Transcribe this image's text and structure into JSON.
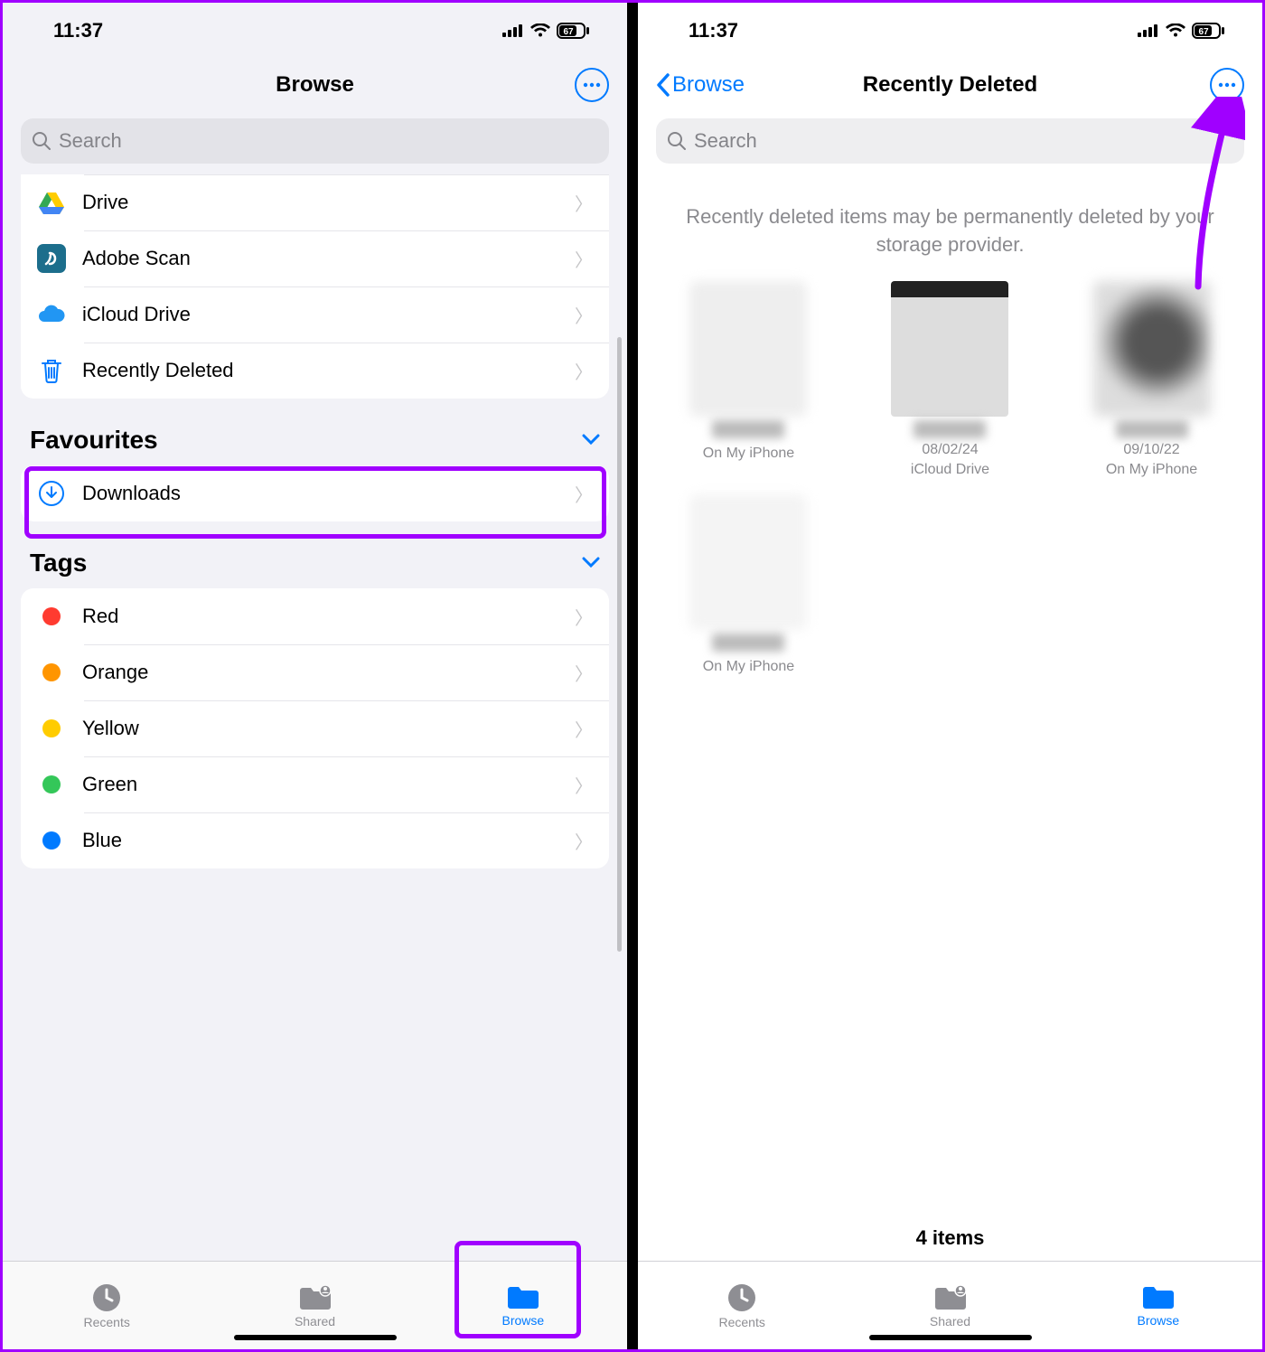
{
  "status": {
    "time": "11:37",
    "battery": "67"
  },
  "screen1": {
    "title": "Browse",
    "search_placeholder": "Search",
    "locations": [
      {
        "label": "Drive",
        "icon": "drive"
      },
      {
        "label": "Adobe Scan",
        "icon": "adobe"
      },
      {
        "label": "iCloud Drive",
        "icon": "icloud"
      },
      {
        "label": "Recently Deleted",
        "icon": "trash"
      }
    ],
    "favourites_title": "Favourites",
    "favourites": [
      {
        "label": "Downloads",
        "icon": "download"
      }
    ],
    "tags_title": "Tags",
    "tags": [
      {
        "label": "Red",
        "color": "#ff3b30"
      },
      {
        "label": "Orange",
        "color": "#ff9500"
      },
      {
        "label": "Yellow",
        "color": "#ffcc00"
      },
      {
        "label": "Green",
        "color": "#34c759"
      },
      {
        "label": "Blue",
        "color": "#007aff"
      }
    ]
  },
  "screen2": {
    "back_label": "Browse",
    "title": "Recently Deleted",
    "search_placeholder": "Search",
    "info_text": "Recently deleted items may be permanently deleted by your storage provider.",
    "items": [
      {
        "date": "",
        "location": "On My iPhone"
      },
      {
        "date": "08/02/24",
        "location": "iCloud Drive"
      },
      {
        "date": "09/10/22",
        "location": "On My iPhone"
      },
      {
        "date": "",
        "location": "On My iPhone"
      }
    ],
    "count_label": "4 items"
  },
  "tabs": {
    "recents": "Recents",
    "shared": "Shared",
    "browse": "Browse"
  }
}
